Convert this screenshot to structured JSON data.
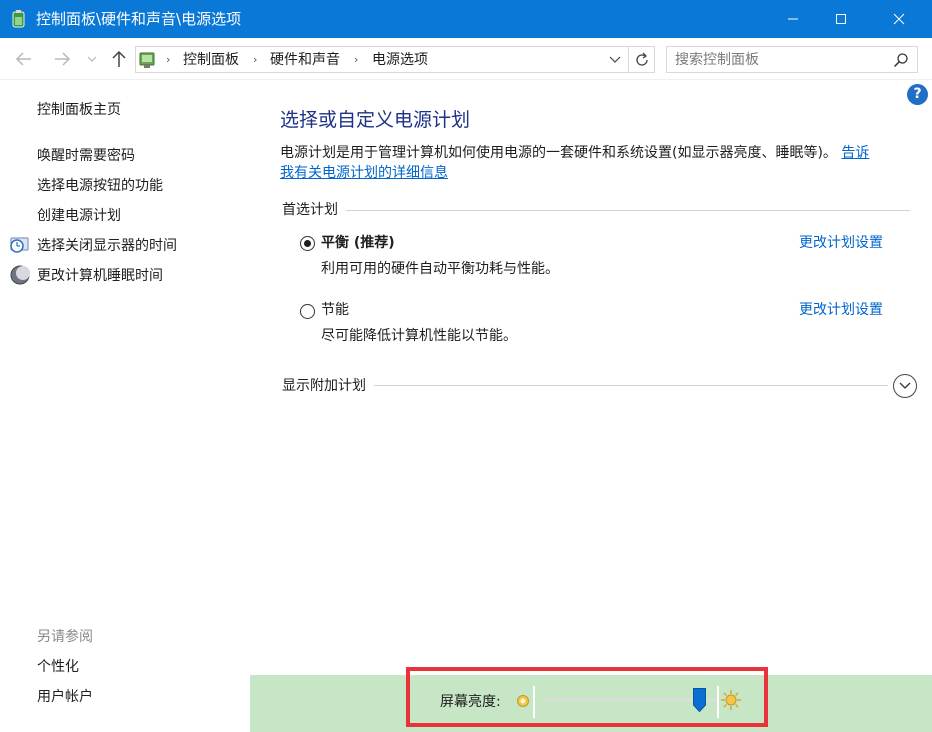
{
  "window": {
    "title": "控制面板\\硬件和声音\\电源选项",
    "controls": {
      "minimize": "minimize",
      "maximize": "maximize",
      "close": "close"
    }
  },
  "address": {
    "crumbs": [
      "控制面板",
      "硬件和声音",
      "电源选项"
    ],
    "search_placeholder": "搜索控制面板"
  },
  "sidebar": {
    "home": "控制面板主页",
    "items": [
      {
        "label": "唤醒时需要密码",
        "icon": ""
      },
      {
        "label": "选择电源按钮的功能",
        "icon": ""
      },
      {
        "label": "创建电源计划",
        "icon": ""
      },
      {
        "label": "选择关闭显示器的时间",
        "icon": "monitor-clock-icon"
      },
      {
        "label": "更改计算机睡眠时间",
        "icon": "moon-icon"
      }
    ],
    "see_also_title": "另请参阅",
    "see_also": [
      "个性化",
      "用户帐户"
    ]
  },
  "main": {
    "title": "选择或自定义电源计划",
    "description": "电源计划是用于管理计算机如何使用电源的一套硬件和系统设置(如显示器亮度、睡眠等)。",
    "description_link": "告诉我有关电源计划的详细信息",
    "description_link_part1": "告诉",
    "description_link_part2": "我有关电源计划的详细信息",
    "preferred_section": "首选计划",
    "plans": [
      {
        "name": "平衡 (推荐)",
        "description": "利用可用的硬件自动平衡功耗与性能。",
        "change": "更改计划设置",
        "selected": true
      },
      {
        "name": "节能",
        "description": "尽可能降低计算机性能以节能。",
        "change": "更改计划设置",
        "selected": false
      }
    ],
    "additional_section": "显示附加计划"
  },
  "brightness": {
    "label": "屏幕亮度:",
    "level": 0.9
  },
  "colors": {
    "titlebar": "#0a78d7",
    "title_text": "#1e3287",
    "link": "#0066cc",
    "bottom_bar": "#c6e6c6",
    "highlight": "#e8333c",
    "slider_thumb": "#0a6fd0"
  }
}
